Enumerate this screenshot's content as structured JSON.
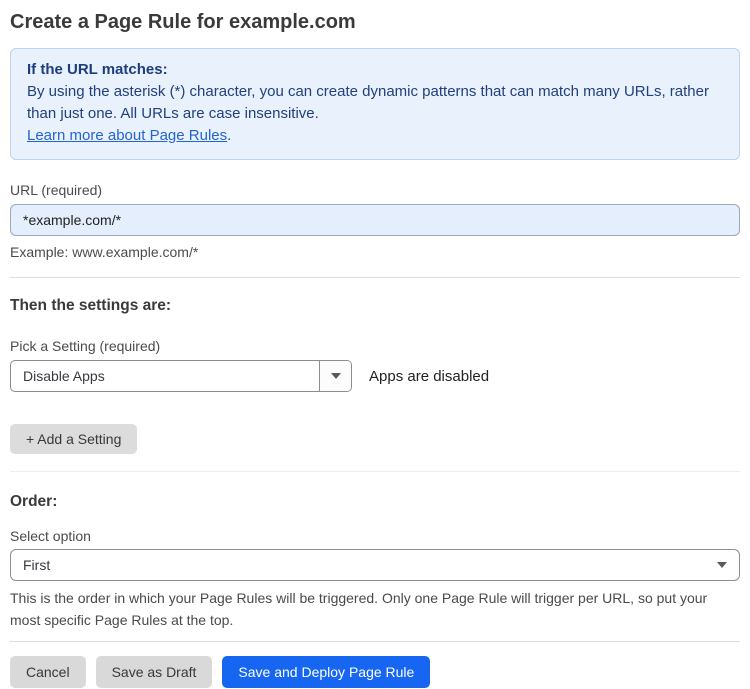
{
  "page": {
    "title": "Create a Page Rule for example.com"
  },
  "info_box": {
    "heading": "If the URL matches:",
    "body": "By using the asterisk (*) character, you can create dynamic patterns that can match many URLs, rather than just one. All URLs are case insensitive.",
    "link_label": "Learn more about Page Rules",
    "link_suffix": "."
  },
  "url_field": {
    "label": "URL (required)",
    "value": "*example.com/*",
    "helper": "Example: www.example.com/*"
  },
  "settings": {
    "heading": "Then the settings are:",
    "picker_label": "Pick a Setting (required)",
    "selected_value": "Disable Apps",
    "status_text": "Apps are disabled",
    "add_button_label": "+ Add a Setting"
  },
  "order": {
    "heading": "Order:",
    "label": "Select option",
    "selected_value": "First",
    "helper": "This is the order in which your Page Rules will be triggered. Only one Page Rule will trigger per URL, so put your most specific Page Rules at the top."
  },
  "actions": {
    "cancel_label": "Cancel",
    "save_draft_label": "Save as Draft",
    "save_deploy_label": "Save and Deploy Page Rule"
  },
  "icons": {
    "setting_dropdown": "caret-down-icon",
    "order_dropdown": "caret-down-icon"
  },
  "colors": {
    "primary_button_blue": "#1766f2",
    "info_box_bg": "#e9f1fc",
    "info_box_border": "#bcd4ef",
    "info_text_navy": "#22407c",
    "link_blue": "#2563cf",
    "url_input_bg": "#e4eefc",
    "gray_button_bg": "#dcdcdc"
  }
}
